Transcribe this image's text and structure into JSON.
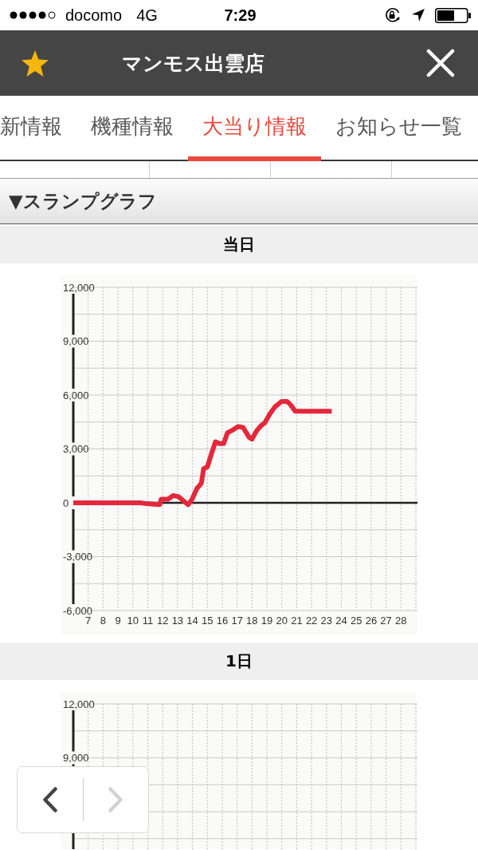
{
  "status_bar": {
    "carrier": "docomo",
    "network": "4G",
    "time": "7:29"
  },
  "header": {
    "title": "マンモス出雲店"
  },
  "tabs": [
    {
      "label": "新情報",
      "selected": false
    },
    {
      "label": "機種情報",
      "selected": false
    },
    {
      "label": "大当り情報",
      "selected": true
    },
    {
      "label": "お知らせ一覧",
      "selected": false
    }
  ],
  "section": {
    "heading": "▼スランプグラフ"
  },
  "days": [
    {
      "kind": "chart",
      "title": "当日",
      "chart_data": {
        "type": "line",
        "grid": true,
        "x": [
          6,
          10.5,
          10.9,
          11.8,
          11.9,
          12.35,
          12.7,
          13.05,
          13.7,
          13.95,
          14.3,
          14.6,
          14.75,
          15.0,
          15.3,
          15.55,
          15.8,
          16.1,
          16.35,
          16.7,
          17.05,
          17.4,
          17.8,
          18.0,
          18.3,
          18.6,
          18.85,
          19.2,
          19.55,
          20.0,
          20.35,
          20.6,
          20.9,
          23.35
        ],
        "series": [
          {
            "color": "#e4283c",
            "values": [
              0,
              0,
              -50,
              -100,
              200,
              200,
              400,
              350,
              -100,
              150,
              800,
              1100,
              1900,
              2000,
              2800,
              3400,
              3300,
              3300,
              3900,
              4050,
              4250,
              4200,
              3650,
              3550,
              4000,
              4300,
              4450,
              4950,
              5350,
              5650,
              5650,
              5450,
              5100,
              5100
            ]
          }
        ],
        "xlim": [
          6,
          29
        ],
        "ylim": [
          -6000,
          12000
        ],
        "xticks": [
          7,
          8,
          9,
          10,
          11,
          12,
          13,
          14,
          15,
          16,
          17,
          18,
          19,
          20,
          21,
          22,
          23,
          24,
          25,
          26,
          27,
          28
        ],
        "yticks": [
          {
            "value": 12000,
            "label": "12,000"
          },
          {
            "value": 9000,
            "label": "9,000"
          },
          {
            "value": 6000,
            "label": "6,000"
          },
          {
            "value": 3000,
            "label": "3,000"
          },
          {
            "value": 0,
            "label": "0"
          },
          {
            "value": -3000,
            "label": "-3,000"
          },
          {
            "value": -6000,
            "label": "-6,000"
          }
        ]
      }
    },
    {
      "kind": "partial",
      "title": "1日",
      "axis_labels": [
        "12,000",
        "9,000"
      ]
    }
  ],
  "pager": [
    {
      "kind": "previous",
      "disabled": false
    },
    {
      "kind": "next",
      "disabled": true
    }
  ]
}
